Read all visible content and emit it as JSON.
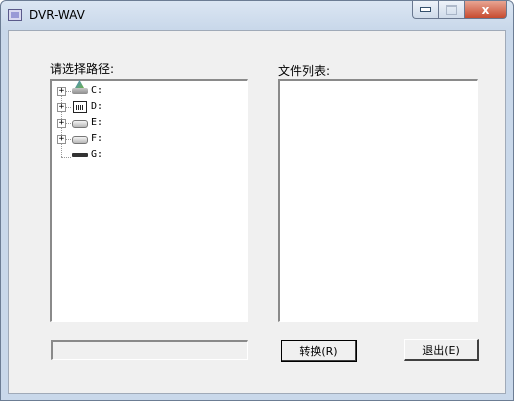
{
  "window": {
    "title": "DVR-WAV"
  },
  "caption": {
    "close_glyph": "x"
  },
  "left_panel": {
    "label": "请选择路径:",
    "drives": [
      {
        "letter": "C:",
        "icon": "system-drive-icon"
      },
      {
        "letter": "D:",
        "icon": "memory-card-drive-icon"
      },
      {
        "letter": "E:",
        "icon": "hard-drive-icon"
      },
      {
        "letter": "F:",
        "icon": "hard-drive-icon"
      },
      {
        "letter": "G:",
        "icon": "removable-drive-icon"
      }
    ],
    "expander_glyph": "+"
  },
  "right_panel": {
    "label": "文件列表:"
  },
  "path_field": {
    "value": ""
  },
  "buttons": {
    "convert_label": "转换(R)",
    "exit_label": "退出(E)"
  },
  "colors": {
    "client_bg": "#f0f0f0",
    "title_bar": "#c9d8ea",
    "close_button": "#c74b2f"
  }
}
